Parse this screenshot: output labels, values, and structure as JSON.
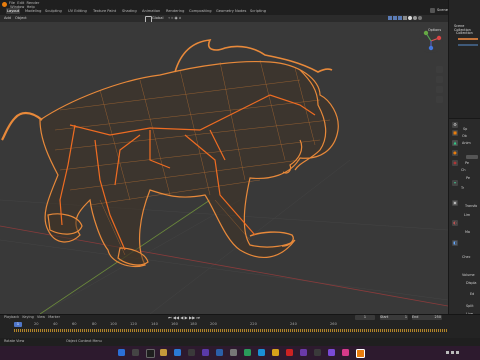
{
  "topbar": {
    "tabs": [
      "Layout",
      "Modeling",
      "Sculpting",
      "UV Editing",
      "Texture Paint",
      "Shading",
      "Animation",
      "Rendering",
      "Compositing",
      "Geometry Nodes",
      "Scripting"
    ],
    "active_tab": "Layout",
    "scene_label": "Scene"
  },
  "header": {
    "mode": "Add",
    "object_menu": "Object",
    "transform": "Global",
    "options": "Options"
  },
  "outliner": {
    "title": "Scene Collection",
    "item1": "Collection"
  },
  "properties": {
    "labels": [
      "Sp",
      "Ob",
      "Anim",
      "Pe",
      "Ch",
      "Pe",
      "Tr",
      "Transfo",
      "Lim",
      "Ma",
      "Chec",
      "Volume",
      "Displa",
      "Ed",
      "Split",
      "Live",
      "Keyp",
      "Cust"
    ]
  },
  "timeline": {
    "playback": "Playback",
    "keying": "Keying",
    "view": "View",
    "marker": "Marker",
    "current_frame": "1",
    "start_label": "Start",
    "start_value": "1",
    "end_label": "End",
    "end_value": "250",
    "ticks": [
      "0",
      "20",
      "40",
      "60",
      "80",
      "100",
      "120",
      "140",
      "160",
      "180",
      "200",
      "220",
      "240",
      "260"
    ],
    "first_frame_marker": "1"
  },
  "statusbar": {
    "left": "Rotate View",
    "right": "Object Context Menu"
  },
  "colors": {
    "wire": "#e8893a",
    "bones": "#ef6c22",
    "accent": "#e87d0d"
  }
}
